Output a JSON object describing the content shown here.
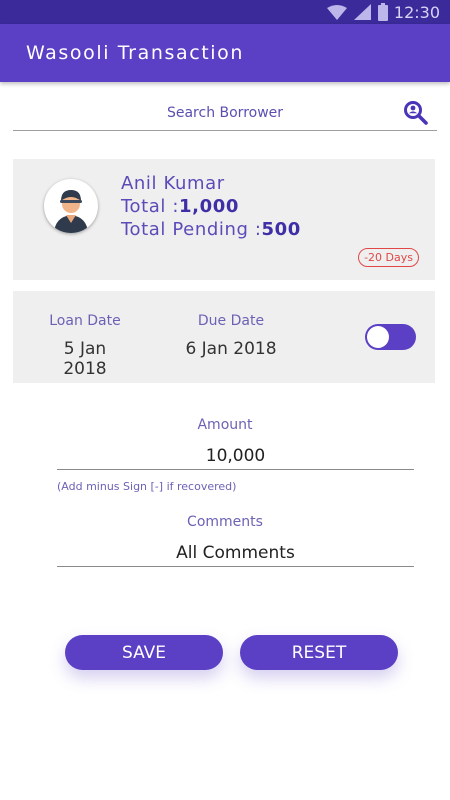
{
  "status_bar": {
    "time": "12:30",
    "icons": [
      "wifi-icon",
      "signal-icon",
      "battery-icon"
    ]
  },
  "app_bar": {
    "title": "Wasooli Transaction"
  },
  "search": {
    "placeholder": "Search Borrower",
    "value": ""
  },
  "borrower": {
    "name": "Anil Kumar",
    "total_label": "Total :",
    "total_value": "1,000",
    "pending_label": "Total Pending :",
    "pending_value": "500",
    "days_badge": "-20 Days"
  },
  "dates": {
    "loan_label": "Loan Date",
    "loan_value": "5 Jan 2018",
    "due_label": "Due Date",
    "due_value": "6 Jan 2018",
    "toggle_on": true
  },
  "amount": {
    "label": "Amount",
    "value": "10,000",
    "hint": "(Add minus Sign [-] if recovered)"
  },
  "comments": {
    "label": "Comments",
    "value": "All Comments"
  },
  "actions": {
    "save_label": "SAVE",
    "reset_label": "RESET"
  },
  "colors": {
    "primary": "#5b3fc4",
    "status_bar": "#3b2a9a",
    "card_bg": "#efefef",
    "badge": "#e04848"
  }
}
